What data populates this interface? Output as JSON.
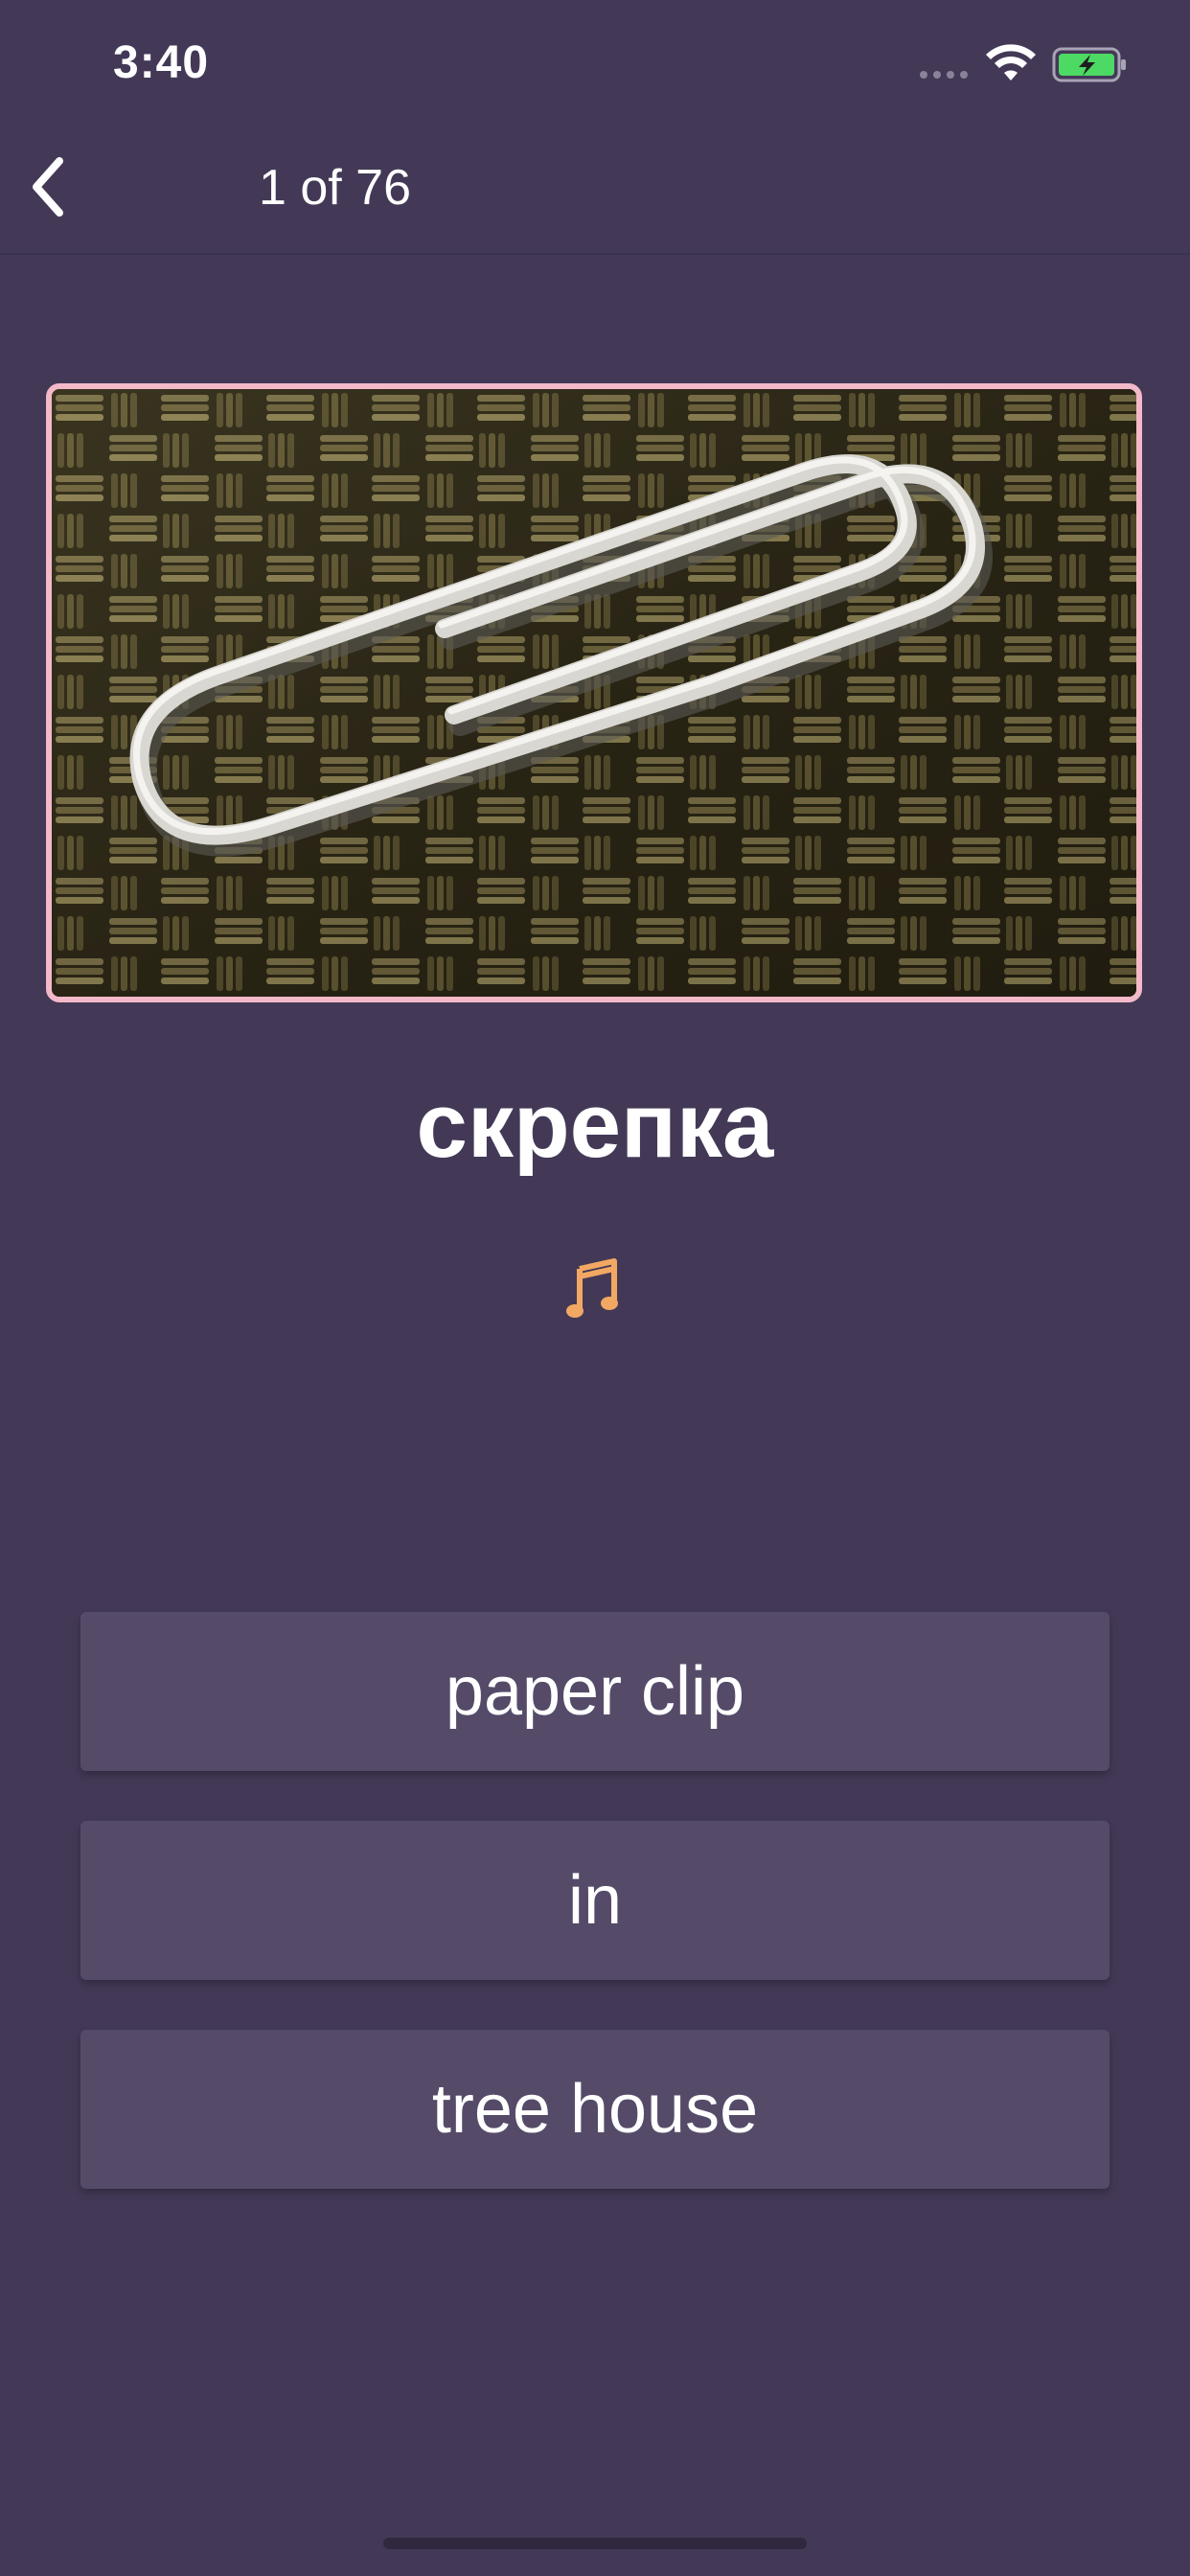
{
  "status_bar": {
    "time": "3:40"
  },
  "nav": {
    "title": "1 of 76"
  },
  "card": {
    "word": "скрепка",
    "audio_icon": "music-note-icon",
    "image_icon": "paper-clip-photo"
  },
  "answers": [
    {
      "label": "paper clip"
    },
    {
      "label": "in"
    },
    {
      "label": "tree house"
    }
  ],
  "colors": {
    "background": "#433957",
    "answer_bg": "#554b69",
    "image_border": "#f3b9c9",
    "audio_icon": "#f2a863",
    "battery_fill": "#4cd964"
  }
}
